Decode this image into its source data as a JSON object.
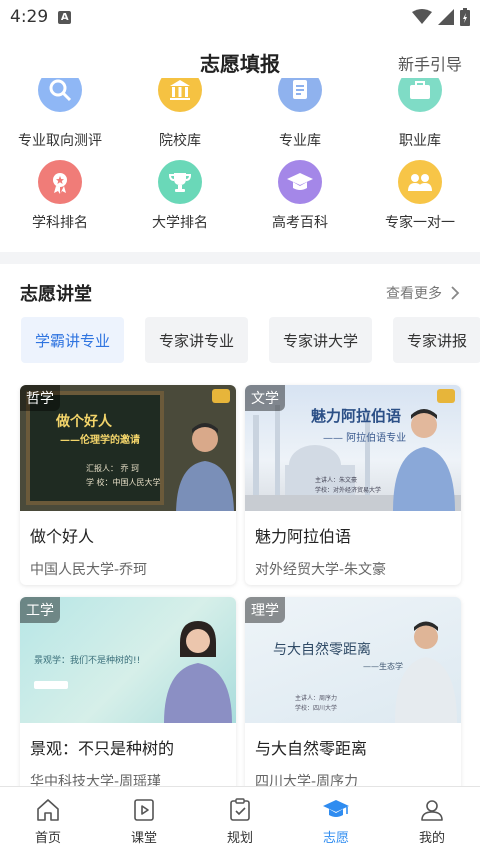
{
  "status_bar": {
    "time": "4:29",
    "notification_glyph": "A"
  },
  "header": {
    "title": "志愿填报",
    "guide": "新手引导"
  },
  "tools_row1": [
    {
      "label": "专业取向测评",
      "icon": "magnifier-icon",
      "color": "#8fb7f5"
    },
    {
      "label": "院校库",
      "icon": "school-building-icon",
      "color": "#f5c242"
    },
    {
      "label": "专业库",
      "icon": "document-icon",
      "color": "#8fb2ee"
    },
    {
      "label": "职业库",
      "icon": "briefcase-icon",
      "color": "#7fdcc6"
    }
  ],
  "tools_row2": [
    {
      "label": "学科排名",
      "icon": "medal-icon",
      "color": "#f07c78"
    },
    {
      "label": "大学排名",
      "icon": "trophy-icon",
      "color": "#6ad8b8"
    },
    {
      "label": "高考百科",
      "icon": "graduation-cap-icon",
      "color": "#a487e8"
    },
    {
      "label": "专家一对一",
      "icon": "experts-icon",
      "color": "#f7c547"
    }
  ],
  "lecture": {
    "title": "志愿讲堂",
    "more": "查看更多",
    "chips": [
      "学霸讲专业",
      "专家讲专业",
      "专家讲大学",
      "专家讲报"
    ],
    "active_chip": 0,
    "cards": [
      {
        "tag": "哲学",
        "title": "做个好人",
        "subtitle": "中国人民大学-乔珂",
        "slide_title": "做个好人",
        "slide_subtitle": "——伦理学的邀请",
        "slide_line1": "汇报人：  乔 珂",
        "slide_line2": "学 校：中国人民大学"
      },
      {
        "tag": "文学",
        "title": "魅力阿拉伯语",
        "subtitle": "对外经贸大学-朱文豪",
        "slide_title": "魅力阿拉伯语",
        "slide_subtitle": "—— 阿拉伯语专业",
        "slide_line1": "主讲人：朱文豪",
        "slide_line2": "学校：对外经济贸易大学"
      },
      {
        "tag": "工学",
        "title": "景观：不只是种树的",
        "subtitle": "华中科技大学-周瑶瑾",
        "slide_title": "景观学：我们不是种树的!!"
      },
      {
        "tag": "理学",
        "title": "与大自然零距离",
        "subtitle": "四川大学-周序力",
        "slide_title": "与大自然零距离",
        "slide_subtitle": "——生态学",
        "slide_line1": "主讲人：周序力",
        "slide_line2": "学校：四川大学"
      }
    ]
  },
  "tabbar": {
    "tabs": [
      {
        "label": "首页",
        "icon": "home-icon"
      },
      {
        "label": "课堂",
        "icon": "play-book-icon"
      },
      {
        "label": "规划",
        "icon": "clipboard-check-icon"
      },
      {
        "label": "志愿",
        "icon": "graduation-cap-icon"
      },
      {
        "label": "我的",
        "icon": "user-icon"
      }
    ],
    "active": 3
  },
  "colors": {
    "accent": "#2f8cf0",
    "chip_active_text": "#2f74e0"
  }
}
